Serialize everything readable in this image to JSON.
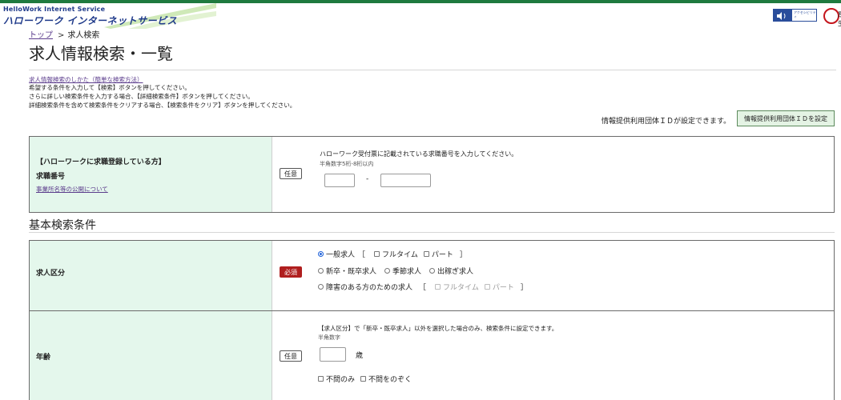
{
  "header": {
    "brand_en": "HelloWork Internet Service",
    "brand_jp": "ハローワーク インターネットサービス",
    "badge_text": "アクセシビリティ",
    "ministry_logo_text": "厚生",
    "icons": [
      "audio-speaker-icon",
      "accessibility-badge-icon",
      "ministry-logo-icon"
    ]
  },
  "breadcrumb": {
    "top": "トップ",
    "sep": ">",
    "current": "求人検索"
  },
  "page": {
    "title": "求人情報検索・一覧"
  },
  "help": {
    "link": "求人情報検索のしかた（簡単な検索方法）",
    "line1": "希望する条件を入力して【検索】ボタンを押してください。",
    "line2": "さらに詳しい検索条件を入力する場合、【詳細検索条件】ボタンを押してください。",
    "line3": "詳細検索条件を含めて検索条件をクリアする場合、【検索条件をクリア】ボタンを押してください。"
  },
  "info": {
    "note": "情報提供利用団体ＩＤが設定できます。",
    "button": "情報提供利用団体ＩＤを設定"
  },
  "job_number": {
    "heading": "【ハローワークに求職登録している方】",
    "label": "求職番号",
    "link": "事業所名等の公開について",
    "optional": "任意",
    "note": "ハローワーク受付票に記載されている求職番号を入力してください。",
    "sub": "半角数字5桁-8桁以内",
    "dash": "-",
    "input1_value": "",
    "input2_value": ""
  },
  "basic": {
    "heading": "基本検索条件"
  },
  "category": {
    "label": "求人区分",
    "required": "必須",
    "general": "一般求人",
    "bracket_open": "［",
    "bracket_close": "］",
    "fulltime": "フルタイム",
    "parttime": "パート",
    "newgrad": "新卒・既卒求人",
    "seasonal": "季節求人",
    "migrant": "出稼ぎ求人",
    "disabled": "障害のある方のための求人",
    "dis_fulltime": "フルタイム",
    "dis_parttime": "パート",
    "selected": "一般求人"
  },
  "age": {
    "label": "年齢",
    "optional": "任意",
    "note": "【求人区分】で「新卒・既卒求人」以外を選択した場合のみ、検索条件に設定できます。",
    "sub": "半角数字",
    "unit": "歳",
    "input_value": "",
    "any_only": "不問のみ",
    "exclude_any": "不問をのぞく"
  }
}
